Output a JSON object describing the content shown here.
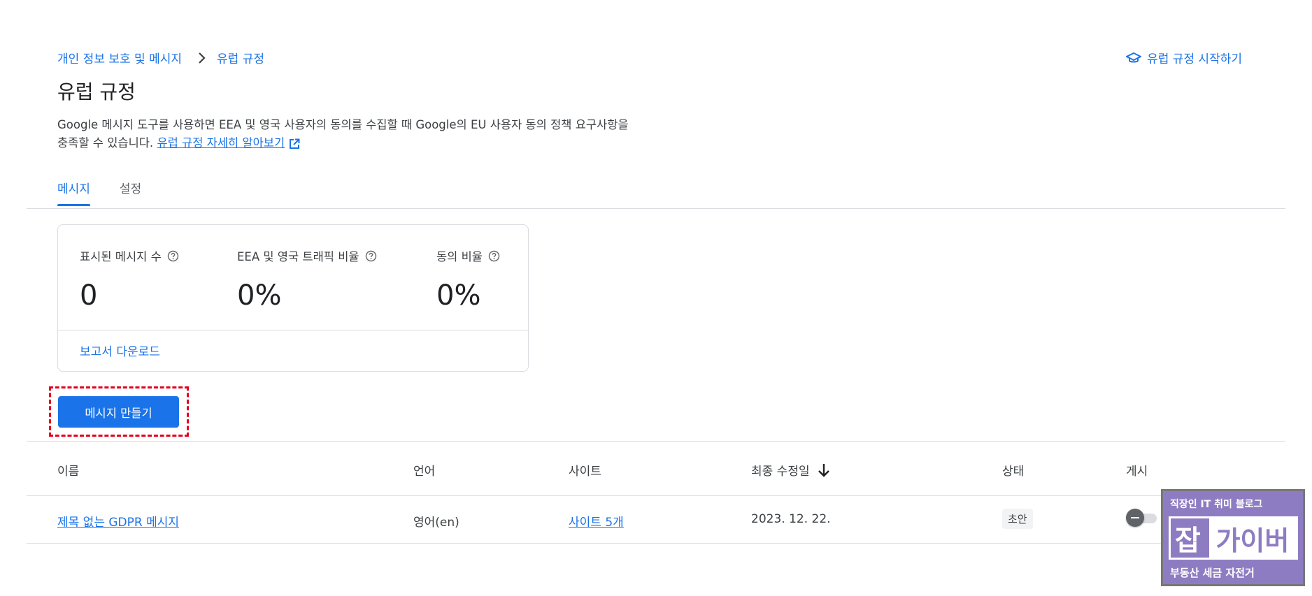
{
  "breadcrumb": {
    "parent": "개인 정보 보호 및 메시지",
    "current": "유럽 규정"
  },
  "header": {
    "get_started_link": "유럽 규정 시작하기",
    "title": "유럽 규정",
    "description": "Google 메시지 도구를 사용하면 EEA 및 영국 사용자의 동의를 수집할 때 Google의 EU 사용자 동의 정책 요구사항을 충족할 수 있습니다.",
    "learn_more_link": "유럽 규정 자세히 알아보기"
  },
  "tabs": [
    {
      "label": "메시지",
      "active": true
    },
    {
      "label": "설정",
      "active": false
    }
  ],
  "stats": {
    "messages_shown_label": "표시된 메시지 수",
    "messages_shown_value": "0",
    "traffic_ratio_label": "EEA 및 영국 트래픽 비율",
    "traffic_ratio_value": "0%",
    "consent_ratio_label": "동의 비율",
    "consent_ratio_value": "0%",
    "download_report": "보고서 다운로드"
  },
  "create_button": "메시지 만들기",
  "table": {
    "columns": [
      "이름",
      "언어",
      "사이트",
      "최종 수정일",
      "상태",
      "게시"
    ],
    "sort_column": "최종 수정일",
    "rows": [
      {
        "name": "제목 없는 GDPR 메시지",
        "language": "영어(en)",
        "sites": "사이트 5개",
        "modified": "2023. 12. 22.",
        "status": "초안",
        "published": false
      }
    ]
  },
  "watermark": {
    "top": "직장인 IT 취미 블로그",
    "big_left": "잡",
    "big_right": "가이버",
    "bottom": "부동산 세금 자전거"
  },
  "colors": {
    "accent": "#1a73e8",
    "highlight": "#e3001b",
    "divider": "#dadce0",
    "watermark_bg": "#8e7cc3"
  }
}
